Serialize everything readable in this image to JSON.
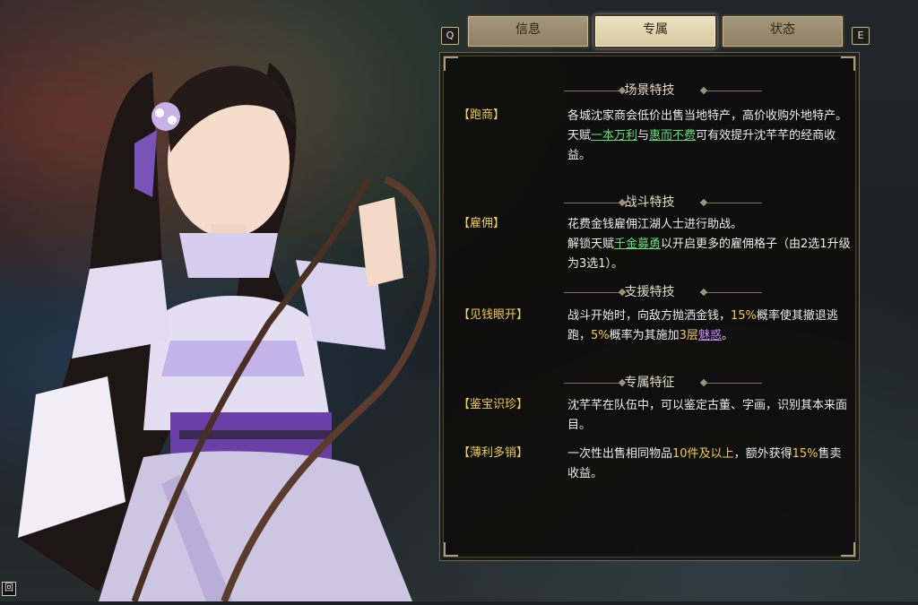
{
  "tabs": {
    "key_left": "Q",
    "key_right": "E",
    "info": "信息",
    "exclusive": "专属",
    "status": "状态"
  },
  "corner_hint": "回",
  "sections": {
    "scene_skills": "场景特技",
    "combat_skills": "战斗特技",
    "support_skills": "支援特技",
    "exclusive_traits": "专属特征"
  },
  "skills": {
    "trade": {
      "tag": "【跑商】",
      "line1": "各城沈家商会低价出售当地特产，高价收购外地特产。",
      "line2_a": "天赋",
      "line2_t1": "一本万利",
      "line2_b": "与",
      "line2_t2": "惠而不费",
      "line2_c": "可有效提升沈芊芊的经商收益。"
    },
    "hire": {
      "tag": "【雇佣】",
      "line1": "花费金钱雇佣江湖人士进行助战。",
      "line2_a": "解锁天赋",
      "line2_t1": "千金募勇",
      "line2_b": "以开启更多的雇佣格子（由2选1升级为3选1）。"
    },
    "greedy": {
      "tag": "【见钱眼开】",
      "p1": "战斗开始时，向敌方抛洒金钱，",
      "v1": "15%",
      "p2": "概率使其撤退逃跑，",
      "v2": "5%",
      "p3": "概率为其施加",
      "v3": "3层",
      "v4": "魅惑",
      "p4": "。"
    },
    "appraise": {
      "tag": "【鉴宝识珍】",
      "line1": "沈芊芊在队伍中，可以鉴定古董、字画，识别其本来面目。"
    },
    "bulk": {
      "tag": "【薄利多销】",
      "p1": "一次性出售相同物品",
      "v1": "10件及以上",
      "p2": "，额外获得",
      "v2": "15%",
      "p3": "售卖收益。"
    }
  },
  "colors": {
    "tag": "#f0cf4a",
    "talent_link": "#5fe07a",
    "highlight": "#f2cd42",
    "status_link": "#c58af0",
    "panel_bg": "#0c0b0a"
  }
}
